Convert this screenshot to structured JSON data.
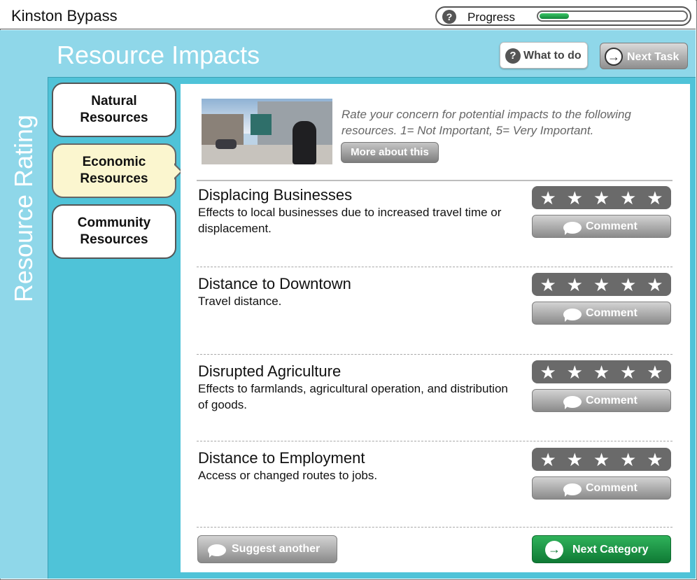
{
  "app": {
    "title": "Kinston Bypass"
  },
  "progress": {
    "label": "Progress",
    "value_fraction": 0.2,
    "help_icon": "question-circle-icon"
  },
  "sidebar": {
    "vertical_label": "Resource Rating"
  },
  "header": {
    "title": "Resource Impacts",
    "what_to_do_label": "What to do",
    "next_task_label": "Next Task"
  },
  "categories": [
    {
      "line1": "Natural",
      "line2": "Resources",
      "active": false
    },
    {
      "line1": "Economic",
      "line2": "Resources",
      "active": true
    },
    {
      "line1": "Community",
      "line2": "Resources",
      "active": false
    }
  ],
  "intro": {
    "text": "Rate your concern for potential impacts to the following resources. 1= Not Important, 5= Very Important.",
    "more_label": "More about this"
  },
  "items": [
    {
      "title": "Displacing Businesses",
      "desc": "Effects to local businesses due to increased travel time or displacement.",
      "rating_max": 5,
      "comment_label": "Comment"
    },
    {
      "title": "Distance to Downtown",
      "desc": "Travel distance.",
      "rating_max": 5,
      "comment_label": "Comment"
    },
    {
      "title": "Disrupted Agriculture",
      "desc": "Effects to farmlands, agricultural operation, and distribution of goods.",
      "rating_max": 5,
      "comment_label": "Comment"
    },
    {
      "title": "Distance to Employment",
      "desc": "Access or changed routes to jobs.",
      "rating_max": 5,
      "comment_label": "Comment"
    }
  ],
  "footer": {
    "suggest_label": "Suggest another",
    "next_category_label": "Next Category"
  },
  "colors": {
    "accent_blue": "#4fc3d8",
    "light_blue": "#8fd7e9",
    "active_tab": "#fbf6cf",
    "next_green": "#12873b"
  }
}
